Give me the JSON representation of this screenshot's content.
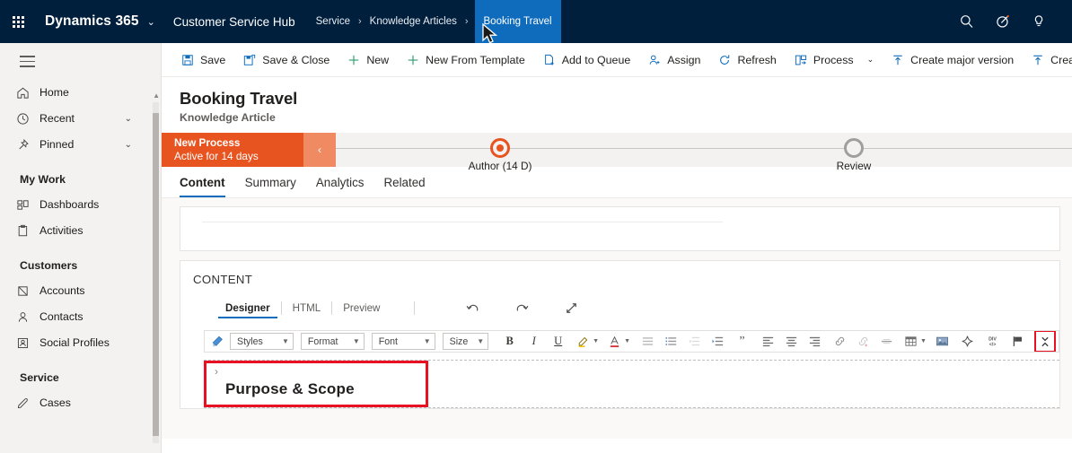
{
  "topnav": {
    "waffle_icon": "app-launcher-icon",
    "brand": "Dynamics 365",
    "brand_chevron": "⌄",
    "app_title": "Customer Service Hub",
    "breadcrumbs": [
      {
        "label": "Service",
        "active": false
      },
      {
        "label": "Knowledge Articles",
        "active": false
      },
      {
        "label": "Booking Travel",
        "active": true
      }
    ],
    "separator": "›",
    "right_icons": [
      "search-icon",
      "assistant-icon",
      "lightbulb-icon"
    ],
    "accent": "#0f6cbd",
    "background": "#001f3d"
  },
  "sidebar": {
    "menu_icon": "hamburger-icon",
    "items": [
      {
        "label": "Home",
        "icon": "home-icon",
        "chevron": false
      },
      {
        "label": "Recent",
        "icon": "clock-icon",
        "chevron": true
      },
      {
        "label": "Pinned",
        "icon": "pin-icon",
        "chevron": true
      }
    ],
    "groups": [
      {
        "title": "My Work",
        "items": [
          {
            "label": "Dashboards",
            "icon": "dashboard-icon"
          },
          {
            "label": "Activities",
            "icon": "activities-icon"
          }
        ]
      },
      {
        "title": "Customers",
        "items": [
          {
            "label": "Accounts",
            "icon": "account-icon"
          },
          {
            "label": "Contacts",
            "icon": "contact-icon"
          },
          {
            "label": "Social Profiles",
            "icon": "social-profile-icon"
          }
        ]
      },
      {
        "title": "Service",
        "items": [
          {
            "label": "Cases",
            "icon": "case-icon"
          }
        ]
      }
    ],
    "chevron_glyph": "⌄"
  },
  "commandbar": {
    "commands": [
      {
        "label": "Save",
        "icon": "save-icon"
      },
      {
        "label": "Save & Close",
        "icon": "save-close-icon"
      },
      {
        "label": "New",
        "icon": "plus-icon"
      },
      {
        "label": "New From Template",
        "icon": "plus-icon"
      },
      {
        "label": "Add to Queue",
        "icon": "add-to-queue-icon"
      },
      {
        "label": "Assign",
        "icon": "assign-icon"
      },
      {
        "label": "Refresh",
        "icon": "refresh-icon"
      },
      {
        "label": "Process",
        "icon": "process-icon",
        "chevron": true
      },
      {
        "label": "Create major version",
        "icon": "upload-icon"
      },
      {
        "label": "Create minor v",
        "icon": "upload-icon"
      }
    ],
    "chevron_glyph": "⌄"
  },
  "record": {
    "title": "Booking Travel",
    "subtitle": "Knowledge Article"
  },
  "process": {
    "stage_name": "New Process",
    "stage_status": "Active for 14 days",
    "collapse_glyph": "‹",
    "color": "#e8541f",
    "steps": [
      {
        "label": "Author",
        "duration": "(14 D)",
        "state": "active"
      },
      {
        "label": "Review",
        "duration": "",
        "state": "inactive"
      }
    ]
  },
  "tabs": [
    {
      "label": "Content",
      "active": true
    },
    {
      "label": "Summary",
      "active": false
    },
    {
      "label": "Analytics",
      "active": false
    },
    {
      "label": "Related",
      "active": false
    }
  ],
  "content_section": {
    "label": "CONTENT",
    "editor_modes": [
      {
        "label": "Designer",
        "active": true
      },
      {
        "label": "HTML",
        "active": false
      },
      {
        "label": "Preview",
        "active": false
      }
    ],
    "editor_actions": [
      {
        "name": "undo-icon"
      },
      {
        "name": "redo-icon"
      },
      {
        "name": "expand-icon"
      }
    ],
    "toolbar": {
      "format_painter": "format-painter-icon",
      "selects": [
        {
          "label": "Styles",
          "width": 78
        },
        {
          "label": "Format",
          "width": 78
        },
        {
          "label": "Font",
          "width": 78
        },
        {
          "label": "Size",
          "width": 52
        }
      ],
      "buttons": [
        {
          "name": "bold-icon",
          "glyph": "B",
          "bold": true
        },
        {
          "name": "italic-icon",
          "glyph": "I",
          "italic": true
        },
        {
          "name": "underline-icon",
          "glyph": "U",
          "underline": true
        },
        {
          "name": "text-highlight-icon",
          "caret": true
        },
        {
          "name": "font-color-icon",
          "caret": true
        },
        {
          "name": "bulleted-list-icon"
        },
        {
          "name": "numbered-list-icon"
        },
        {
          "name": "decrease-indent-icon"
        },
        {
          "name": "increase-indent-icon"
        },
        {
          "name": "blockquote-icon"
        },
        {
          "name": "align-left-icon"
        },
        {
          "name": "align-center-icon"
        },
        {
          "name": "align-right-icon"
        },
        {
          "name": "insert-link-icon"
        },
        {
          "name": "remove-link-icon"
        },
        {
          "name": "horizontal-rule-icon"
        },
        {
          "name": "insert-table-icon",
          "caret": true
        },
        {
          "name": "insert-image-icon"
        },
        {
          "name": "sparkle-icon"
        },
        {
          "name": "source-code-icon"
        },
        {
          "name": "flag-icon"
        },
        {
          "name": "collapse-toolbar-icon",
          "highlighted": true
        }
      ]
    },
    "editor_body": {
      "collapse_glyph": "›",
      "heading": "Purpose & Scope",
      "highlighted": true
    }
  },
  "highlight_color": "#e81123"
}
